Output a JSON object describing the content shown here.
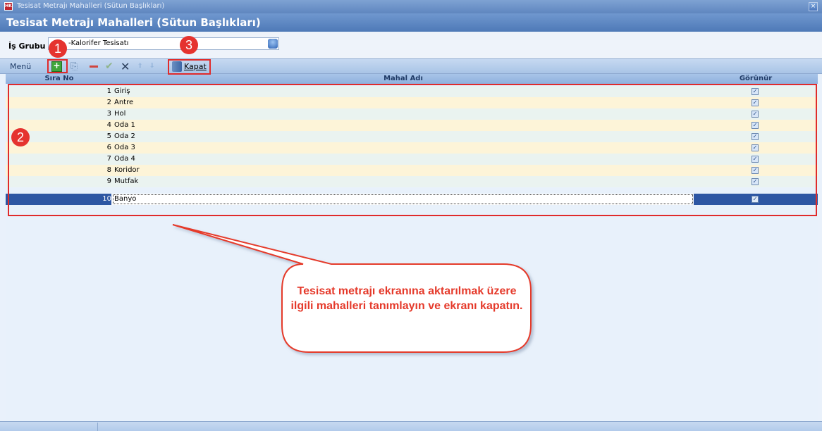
{
  "window": {
    "title": "Tesisat Metrajı Mahalleri (Sütun Başlıkları)",
    "app_icon": "HK",
    "close_glyph": "×"
  },
  "header": {
    "title": "Tesisat Metrajı Mahalleri (Sütun Başlıkları)"
  },
  "is_grubu": {
    "label": "İş Grubu",
    "value": "-Kalorifer Tesisatı"
  },
  "menu": {
    "label": "Menü",
    "kapat_label": "Kapat",
    "icons": [
      "add-icon",
      "copy-icon",
      "delete-icon",
      "confirm-icon",
      "cancel-icon",
      "move-up-icon",
      "move-down-icon",
      "close-door-icon"
    ]
  },
  "grid": {
    "columns": [
      "Sıra No",
      "Mahal Adı",
      "Görünür"
    ],
    "rows": [
      {
        "no": "1",
        "name": "Giriş",
        "visible": true
      },
      {
        "no": "2",
        "name": "Antre",
        "visible": true
      },
      {
        "no": "3",
        "name": "Hol",
        "visible": true
      },
      {
        "no": "4",
        "name": "Oda 1",
        "visible": true
      },
      {
        "no": "5",
        "name": "Oda 2",
        "visible": true
      },
      {
        "no": "6",
        "name": "Oda 3",
        "visible": true
      },
      {
        "no": "7",
        "name": "Oda 4",
        "visible": true
      },
      {
        "no": "8",
        "name": "Koridor",
        "visible": true
      },
      {
        "no": "9",
        "name": "Mutfak",
        "visible": true
      },
      {
        "no": "10",
        "name": "Banyo",
        "visible": true
      }
    ],
    "selected_row": "10"
  },
  "annotations": {
    "badge1": "1",
    "badge2": "2",
    "badge3": "3",
    "callout": "Tesisat metrajı ekranına aktarılmak üzere ilgili mahalleri tanımlayın ve ekranı kapatın.",
    "accent_color": "#e02b2b"
  },
  "check_glyph": "✓"
}
